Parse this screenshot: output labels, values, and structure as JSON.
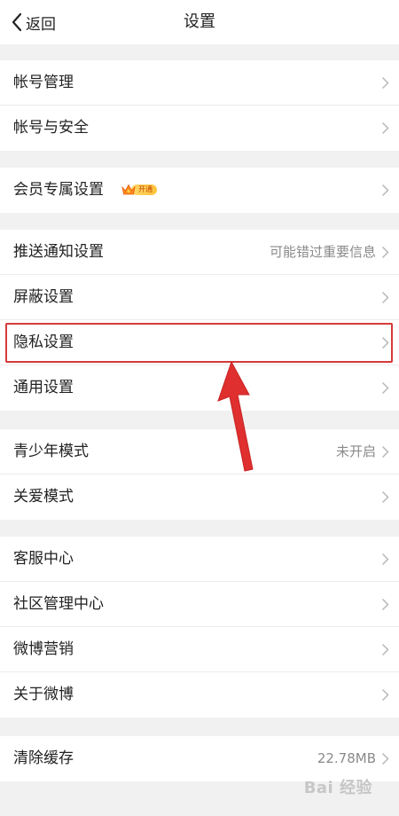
{
  "navbar": {
    "back_label": "返回",
    "title": "设置"
  },
  "groups": [
    {
      "rows": [
        {
          "label": "帐号管理",
          "value": ""
        },
        {
          "label": "帐号与安全",
          "value": ""
        }
      ]
    },
    {
      "rows": [
        {
          "label": "会员专属设置",
          "value": "",
          "badge": "开通"
        }
      ]
    },
    {
      "rows": [
        {
          "label": "推送通知设置",
          "value": "可能错过重要信息"
        },
        {
          "label": "屏蔽设置",
          "value": ""
        },
        {
          "label": "隐私设置",
          "value": ""
        },
        {
          "label": "通用设置",
          "value": ""
        }
      ]
    },
    {
      "rows": [
        {
          "label": "青少年模式",
          "value": "未开启"
        },
        {
          "label": "关爱模式",
          "value": ""
        }
      ]
    },
    {
      "rows": [
        {
          "label": "客服中心",
          "value": ""
        },
        {
          "label": "社区管理中心",
          "value": ""
        },
        {
          "label": "微博营销",
          "value": ""
        },
        {
          "label": "关于微博",
          "value": ""
        }
      ]
    },
    {
      "rows": [
        {
          "label": "清除缓存",
          "value": "22.78MB"
        }
      ]
    }
  ],
  "watermark": "Bai 经验",
  "colors": {
    "highlight": "#d63a3a",
    "background": "#f1f1f1",
    "card": "#ffffff"
  }
}
